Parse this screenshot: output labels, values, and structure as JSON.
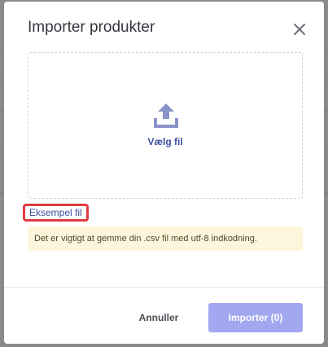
{
  "dialog": {
    "title": "Importer produkter",
    "close_icon": "close-icon"
  },
  "dropzone": {
    "icon": "upload-icon",
    "label": "Vælg fil"
  },
  "sample_link": "Eksempel fil",
  "notice": "Det er vigtigt at gemme din .csv fil med utf-8 indkodning.",
  "footer": {
    "cancel_label": "Annuller",
    "import_label": "Importer (0)"
  },
  "colors": {
    "accent": "#3d4e9e",
    "primary_button_disabled": "#a2a8ef",
    "notice_bg": "#fdf6dc",
    "highlight_border": "#e23b44"
  }
}
